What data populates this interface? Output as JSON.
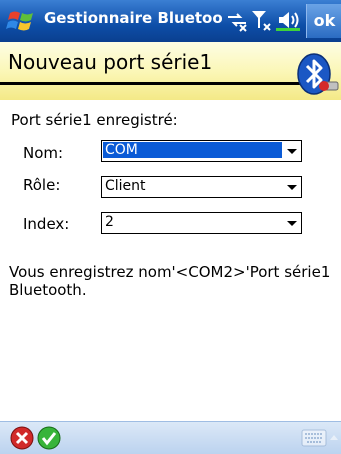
{
  "titlebar": {
    "title": "Gestionnaire Bluetoo",
    "ok_label": "ok",
    "icons": [
      "windows-start-icon",
      "connectivity-icon",
      "signal-icon",
      "volume-icon"
    ]
  },
  "header": {
    "title": "Nouveau port série1",
    "badge_icon": "bluetooth-icon"
  },
  "form": {
    "section_label": "Port série1 enregistré:",
    "fields": [
      {
        "label": "Nom:",
        "value": "COM"
      },
      {
        "label": "Rôle:",
        "value": "Client"
      },
      {
        "label": "Index:",
        "value": "2"
      }
    ]
  },
  "message": "Vous enregistrez nom'<COM2>'Port série1 Bluetooth.",
  "bottombar": {
    "icons": [
      "cancel-icon",
      "confirm-icon",
      "keyboard-icon"
    ]
  }
}
